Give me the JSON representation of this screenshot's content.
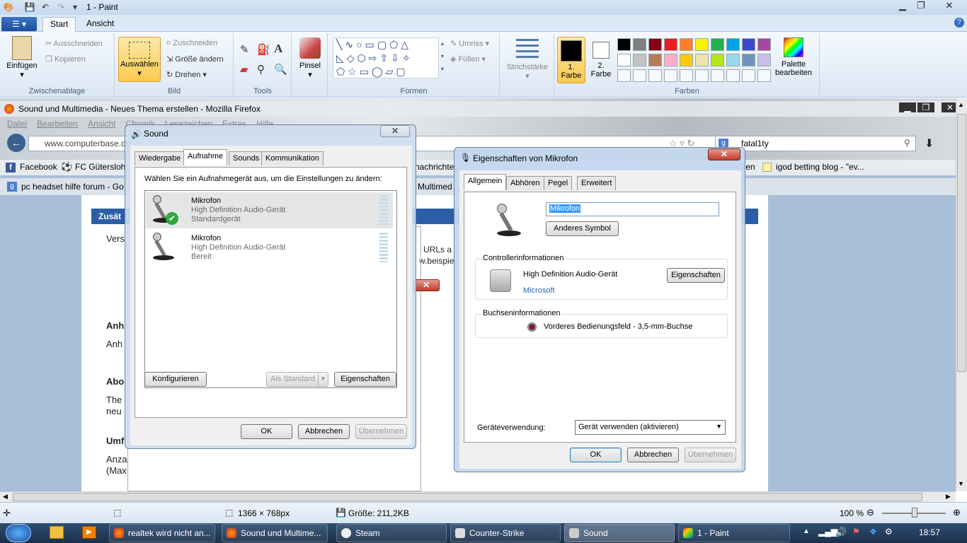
{
  "paint": {
    "title": "1 - Paint",
    "tabs": [
      {
        "label": "Start"
      },
      {
        "label": "Ansicht"
      }
    ],
    "clipboard": {
      "paste": "Einfügen",
      "cut": "Ausschneiden",
      "copy": "Kopieren",
      "group": "Zwischenablage"
    },
    "image": {
      "select": "Auswählen",
      "crop": "Zuschneiden",
      "resize": "Größe ändern",
      "rotate": "Drehen",
      "group": "Bild"
    },
    "tools_group": "Tools",
    "brush": "Pinsel",
    "shapes": {
      "outline": "Umriss",
      "fill": "Füllen",
      "group": "Formen"
    },
    "stroke": "Strichstärke",
    "color1": {
      "num": "1.",
      "label": "Farbe"
    },
    "color2": {
      "num": "2.",
      "label": "Farbe"
    },
    "palette_edit": {
      "line1": "Palette",
      "line2": "bearbeiten"
    },
    "colors_group": "Farben",
    "palette_row1": [
      "#000000",
      "#7f7f7f",
      "#880015",
      "#ed1c24",
      "#ff7f27",
      "#fff200",
      "#22b14c",
      "#00a2e8",
      "#3f48cc",
      "#a349a4"
    ],
    "palette_row2": [
      "#ffffff",
      "#c3c3c3",
      "#b97a57",
      "#ffaec9",
      "#ffc90e",
      "#efe4b0",
      "#b5e61d",
      "#99d9ea",
      "#7092be",
      "#c8bfe7"
    ],
    "status": {
      "size": "1366 × 768px",
      "filesize": "Größe: 211,2KB",
      "zoom": "100 %"
    }
  },
  "firefox": {
    "title": "Sound und Multimedia - Neues Thema erstellen - Mozilla Firefox",
    "menu": [
      "Datei",
      "Bearbeiten",
      "Ansicht",
      "Chronik",
      "Lesezeichen",
      "Extras",
      "Hilfe"
    ],
    "url": "www.computerbase.de",
    "search": "fatal1ty",
    "bookmarks": [
      "Facebook",
      "FC Gütersloh",
      "nachrichten -",
      "llen",
      "igod betting blog - \"ev..."
    ],
    "tabs": [
      "pc headset hilfe forum - Go",
      "Multimed"
    ],
    "page_header": "Zusät",
    "page_texts": [
      "Vers",
      "URLs a",
      "w.beispie",
      "Anh",
      "Anh",
      "Abo",
      "The",
      "neu",
      "Umf",
      "Anza",
      "(Max"
    ]
  },
  "sound_dialog": {
    "title": "Sound",
    "tabs": [
      "Wiedergabe",
      "Aufnahme",
      "Sounds",
      "Kommunikation"
    ],
    "active_tab": "Aufnahme",
    "instruction": "Wählen Sie ein Aufnahmegerät aus, um die Einstellungen zu ändern:",
    "devices": [
      {
        "name": "Mikrofon",
        "desc": "High Definition Audio-Gerät",
        "state": "Standardgerät"
      },
      {
        "name": "Mikrofon",
        "desc": "High Definition Audio-Gerät",
        "state": "Bereit"
      }
    ],
    "configure": "Konfigurieren",
    "set_default": "Als Standard",
    "properties": "Eigenschaften",
    "ok": "OK",
    "cancel": "Abbrechen",
    "apply": "Übernehmen"
  },
  "props_dialog": {
    "title": "Eigenschaften von Mikrofon",
    "tabs": [
      "Allgemein",
      "Abhören",
      "Pegel",
      "Erweitert"
    ],
    "active_tab": "Allgemein",
    "name_value": "Mikrofon",
    "change_icon": "Anderes Symbol",
    "controller_heading": "Controllerinformationen",
    "controller_name": "High Definition Audio-Gerät",
    "controller_vendor": "Microsoft",
    "controller_props": "Eigenschaften",
    "jack_heading": "Buchseninformationen",
    "jack_desc": "Vorderes Bedienungsfeld - 3,5-mm-Buchse",
    "usage_label": "Geräteverwendung:",
    "usage_value": "Gerät verwenden (aktivieren)",
    "ok": "OK",
    "cancel": "Abbrechen",
    "apply": "Übernehmen"
  },
  "taskbar": {
    "items": [
      {
        "label": "realtek wird nicht an..."
      },
      {
        "label": "Sound und Multime..."
      },
      {
        "label": "Steam"
      },
      {
        "label": "Counter-Strike"
      },
      {
        "label": "Sound"
      },
      {
        "label": "1 - Paint"
      }
    ],
    "clock": "18:57"
  }
}
